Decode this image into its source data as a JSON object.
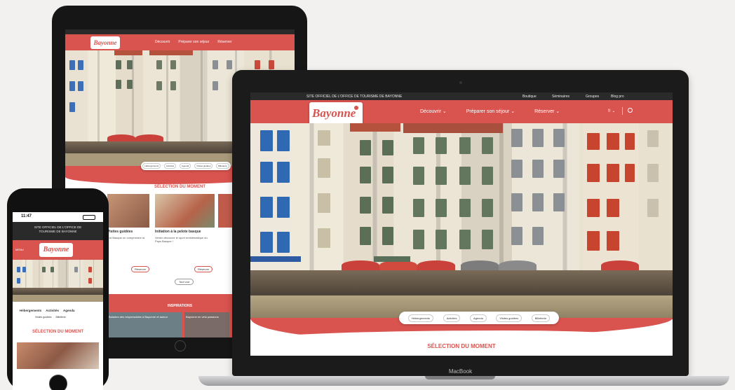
{
  "desktop": {
    "topbar": {
      "official": "SITE OFFICIEL DE L'OFFICE DE TOURISME DE BAYONNE",
      "links": [
        "Boutique",
        "Séminaires",
        "Groupes",
        "Blog pro"
      ]
    },
    "logo": {
      "brand": "Bayonne"
    },
    "nav": [
      "Découvrir",
      "Préparer son séjour",
      "Réserver"
    ],
    "chips": [
      "Hébergements",
      "Activités",
      "Agenda",
      "Visites guidées",
      "Billetterie"
    ],
    "selection_title": "SÉLECTION DU MOMENT"
  },
  "macbook_label": "MacBook",
  "tablet": {
    "nav": [
      "Découvrir",
      "Préparer son séjour",
      "Réserver"
    ],
    "chips": [
      "Hébergements",
      "Activités",
      "Agenda",
      "Visites guidées",
      "Billetterie"
    ],
    "selection_title": "SÉLECTION DU MOMENT",
    "cards": [
      {
        "title": "Visites guidées",
        "text": "Cut Basque on comprendre la",
        "button": "Réserver"
      },
      {
        "title": "Initiation à la pelote basque",
        "text": "Venez découvrir le sport emblématique du Pays Basque !",
        "button": "Réserver"
      }
    ],
    "all_button": "Tout voir",
    "band_title": "INSPIRATIONS",
    "bottom_texts": [
      "Balades des responsables à Bayonne et autour",
      "Bayonne en vélo passions"
    ]
  },
  "phone": {
    "time": "11:47",
    "official": "SITE OFFICIEL DE L'OFFICE DE TOURISME DE BAYONNE",
    "menu": "MENU",
    "chips_row1": [
      "Hébergements",
      "Activités",
      "Agenda"
    ],
    "chips_row2": [
      "Visites guidées",
      "Billetterie"
    ],
    "selection_title": "SÉLECTION DU MOMENT"
  },
  "colors": {
    "brand_red": "#d9534f",
    "topbar": "#2a2a2a"
  }
}
